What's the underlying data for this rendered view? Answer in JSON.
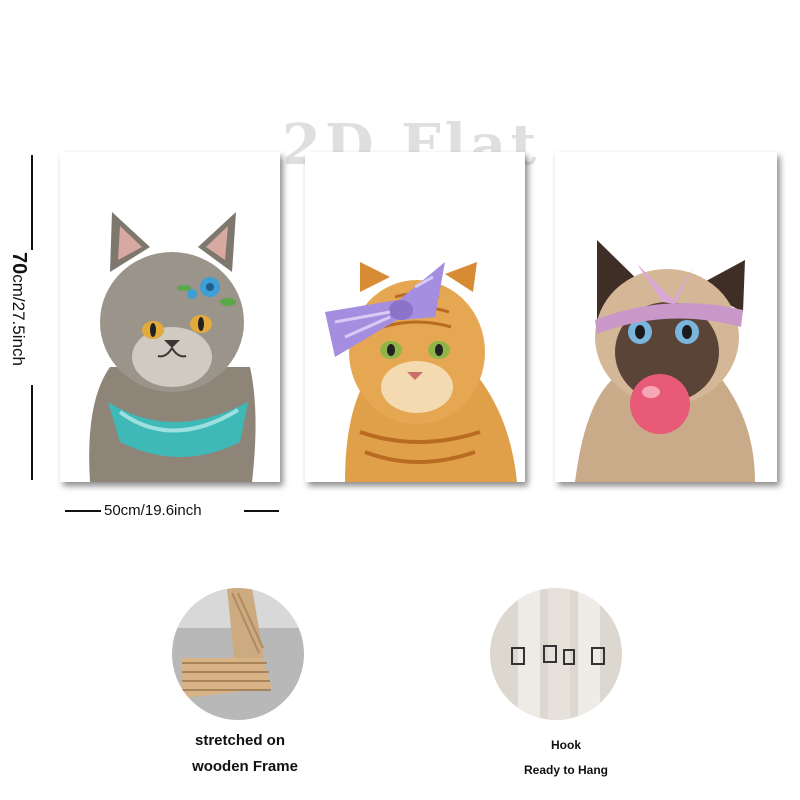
{
  "watermark": "2D Flat",
  "dimensions": {
    "height_label": "70",
    "height_unit": "cm/27.5inch",
    "width_label": "50cm/19.6inch"
  },
  "panels": [
    {
      "subject": "grey cat with teal scarf and blue flower",
      "accent": "#3fb8b8"
    },
    {
      "subject": "orange tabby cat with purple bow",
      "accent": "#a58ee0"
    },
    {
      "subject": "siamese cat blowing pink bubble gum",
      "accent": "#e85a78"
    }
  ],
  "features": [
    {
      "icon": "wooden-frame-icon",
      "line1": "stretched on",
      "line2": "wooden Frame"
    },
    {
      "icon": "hook-icon",
      "line1": "Hook",
      "line2": "Ready to Hang"
    }
  ]
}
